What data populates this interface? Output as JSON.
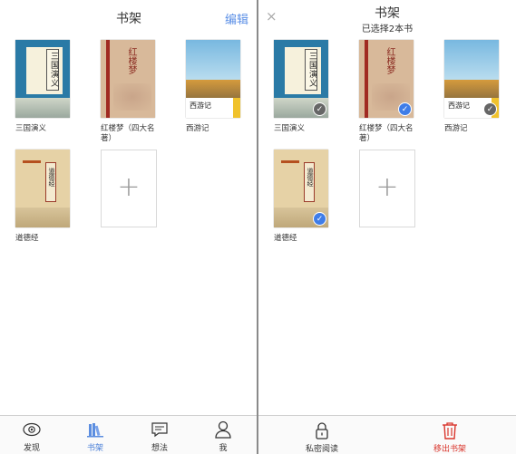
{
  "left": {
    "title": "书架",
    "edit_label": "编辑",
    "books": [
      {
        "name": "三国演义",
        "cover_text": "三国演义"
      },
      {
        "name": "红楼梦（四大名著）",
        "cover_text": "红楼梦"
      },
      {
        "name": "西游记",
        "cover_text": "西游记"
      },
      {
        "name": "道德经",
        "cover_text": "道德经"
      }
    ],
    "tabs": [
      {
        "label": "发现",
        "icon": "eye-icon",
        "active": false
      },
      {
        "label": "书架",
        "icon": "books-icon",
        "active": true
      },
      {
        "label": "想法",
        "icon": "comment-icon",
        "active": false
      },
      {
        "label": "我",
        "icon": "person-icon",
        "active": false
      }
    ]
  },
  "right": {
    "title": "书架",
    "subtitle": "已选择2本书",
    "close_symbol": "×",
    "books": [
      {
        "name": "三国演义",
        "selected": false
      },
      {
        "name": "红楼梦（四大名著）",
        "selected": true
      },
      {
        "name": "西游记",
        "selected": false
      },
      {
        "name": "道德经",
        "selected": true
      }
    ],
    "actions": [
      {
        "label": "私密阅读",
        "icon": "lock-icon"
      },
      {
        "label": "移出书架",
        "icon": "trash-icon"
      }
    ]
  },
  "colors": {
    "accent": "#4a7fd8",
    "danger": "#d9342b",
    "check_on": "#3f7de8",
    "check_off": "#666666"
  },
  "add_symbol": "+",
  "check_symbol": "✓"
}
